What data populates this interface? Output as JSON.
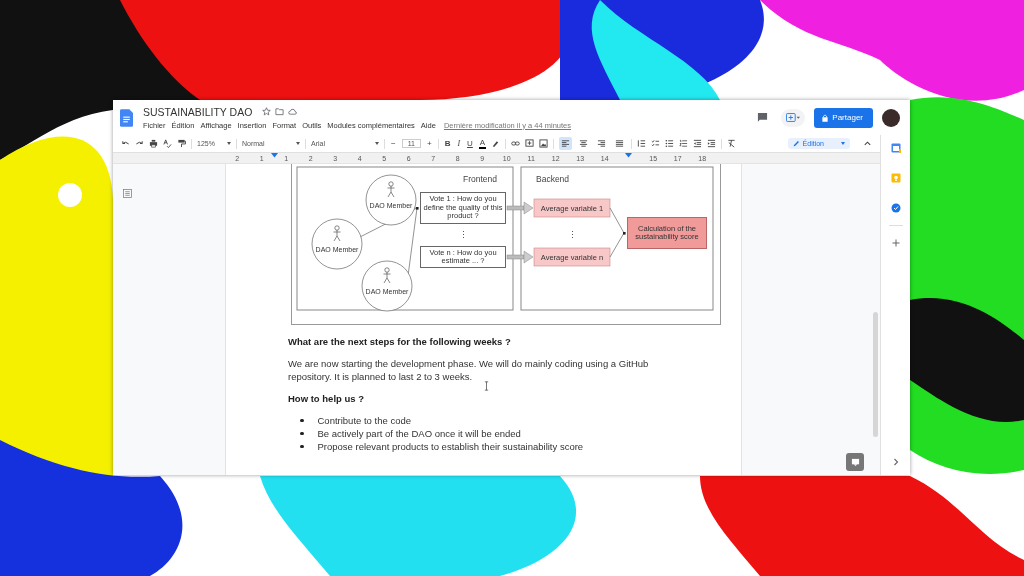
{
  "document": {
    "title": "SUSTAINABILITY DAO",
    "menus": [
      "Fichier",
      "Édition",
      "Affichage",
      "Insertion",
      "Format",
      "Outils",
      "Modules complémentaires",
      "Aide"
    ],
    "last_edit": "Dernière modification il y a 44 minutes"
  },
  "share_button": "Partager",
  "toolbar": {
    "zoom": "125%",
    "style": "Normal",
    "font": "Arial",
    "minus": "−",
    "font_size": "11",
    "plus": "+",
    "bold": "B",
    "italic": "I",
    "underline": "U",
    "text_color": "A",
    "alignments": [
      {
        "kind": "left",
        "selected": true
      },
      {
        "kind": "center",
        "selected": false
      },
      {
        "kind": "right",
        "selected": false
      },
      {
        "kind": "justify",
        "selected": false
      }
    ],
    "mode": "Édition"
  },
  "ruler": [
    "2",
    "1",
    "1",
    "2",
    "3",
    "4",
    "5",
    "6",
    "7",
    "8",
    "9",
    "10",
    "11",
    "12",
    "13",
    "14",
    "15",
    "17",
    "18"
  ],
  "diagram": {
    "frontend_label": "Frontend",
    "backend_label": "Backend",
    "actors": [
      "DAO Member",
      "DAO Member",
      "DAO Member"
    ],
    "votes": [
      {
        "text": "Vote 1 : How do you define the quality of this product ?"
      },
      {
        "text": "Vote n : How do you estimate ... ?"
      }
    ],
    "ellipsis": "⋮",
    "averages": [
      "Average variable 1",
      "Average variable n"
    ],
    "result": "Calculation of the sustainability score"
  },
  "content": [
    {
      "kind": "heading",
      "text": "What are the next steps for the following weeks ?"
    },
    {
      "kind": "paragraph",
      "lines": [
        "We are now starting the development phase. We will do mainly coding using a GitHub",
        "repository. It is planned to last 2 to 3 weeks."
      ]
    },
    {
      "kind": "heading",
      "text": "How to help us ?"
    },
    {
      "kind": "bullets",
      "items": [
        "Contribute to the code",
        "Be actively part of the DAO once it will be ended",
        "Propose relevant products to establish their sustainability score"
      ]
    }
  ]
}
